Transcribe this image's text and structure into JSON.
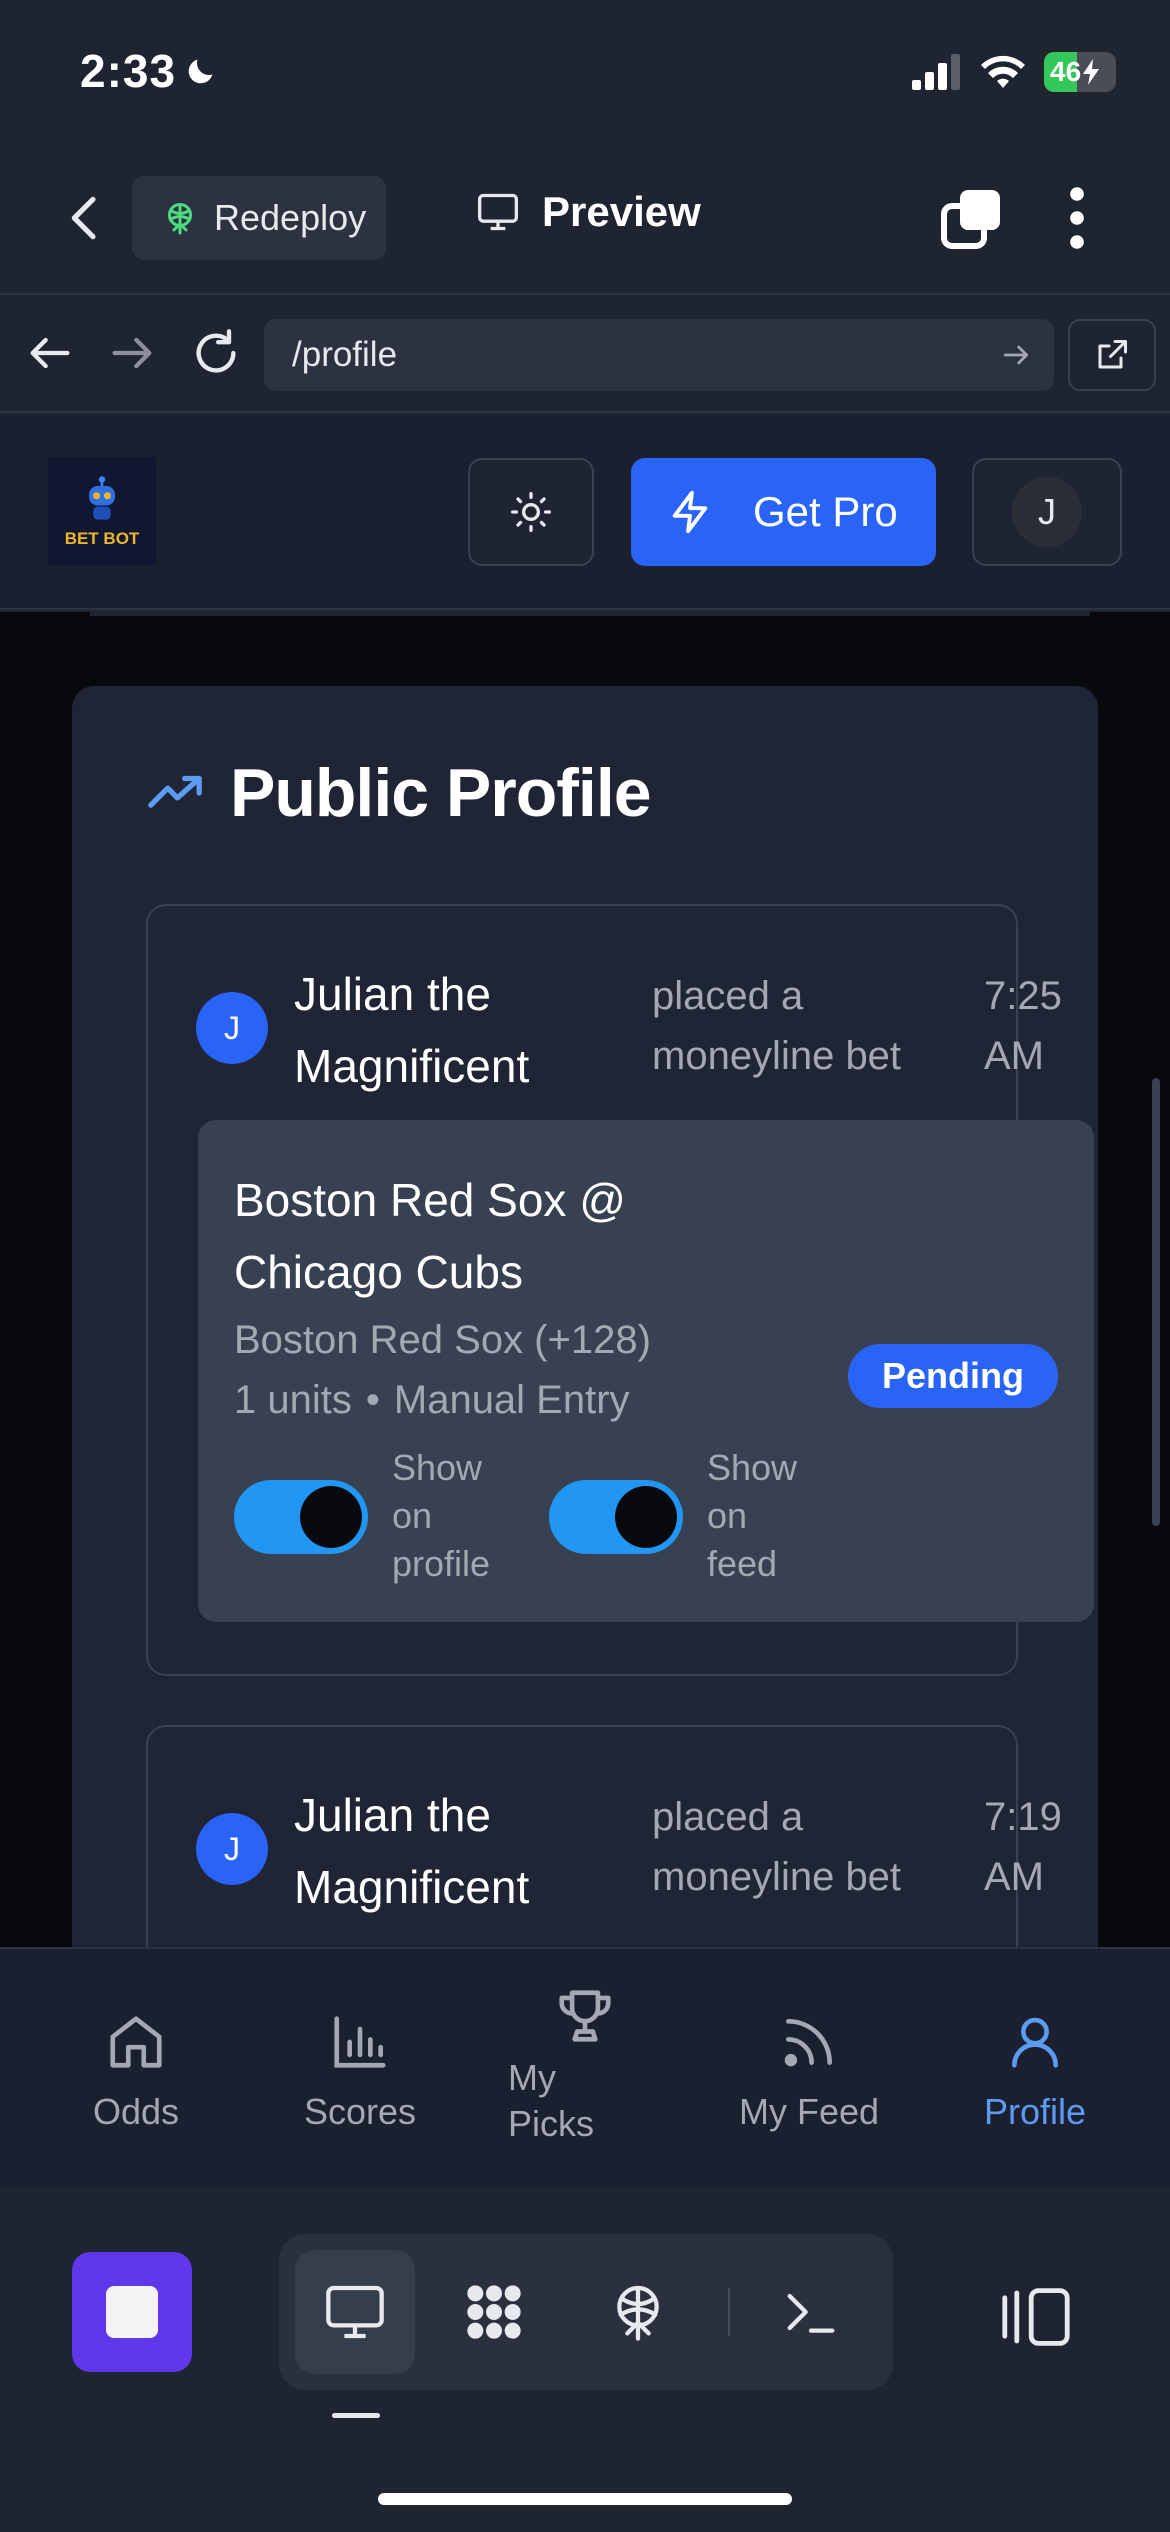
{
  "status_bar": {
    "time": "2:33",
    "battery": "46"
  },
  "editor_bar": {
    "redeploy_label": "Redeploy",
    "preview_label": "Preview"
  },
  "url_bar": {
    "url": "/profile"
  },
  "app_header": {
    "logo_text": "BET BOT",
    "pro_label": "Get Pro",
    "user_initial": "J"
  },
  "profile": {
    "title": "Public Profile",
    "bets": [
      {
        "avatar_initial": "J",
        "user": "Julian the Magnificent",
        "action": "placed a moneyline bet",
        "time": "7:25 AM",
        "game": "Boston Red Sox @ Chicago Cubs",
        "pick": "Boston Red Sox (+128)",
        "units": "1 units",
        "separator": "•",
        "source": "Manual Entry",
        "status": "Pending",
        "toggle_profile_label": "Show on profile",
        "toggle_profile_on": true,
        "toggle_feed_label": "Show on feed",
        "toggle_feed_on": true
      },
      {
        "avatar_initial": "J",
        "user": "Julian the Magnificent",
        "action": "placed a moneyline bet",
        "time": "7:19 AM"
      }
    ]
  },
  "tab_bar": {
    "items": [
      {
        "label": "Odds",
        "icon": "home-icon",
        "active": false
      },
      {
        "label": "Scores",
        "icon": "bar-chart-icon",
        "active": false
      },
      {
        "label": "My Picks",
        "icon": "trophy-icon",
        "active": false
      },
      {
        "label": "My Feed",
        "icon": "rss-icon",
        "active": false
      },
      {
        "label": "Profile",
        "icon": "user-icon",
        "active": true
      }
    ]
  },
  "colors": {
    "accent": "#2a64f6",
    "toggle": "#2196f3",
    "active_tab": "#5b9bf2",
    "stop_button": "#6137ea"
  }
}
